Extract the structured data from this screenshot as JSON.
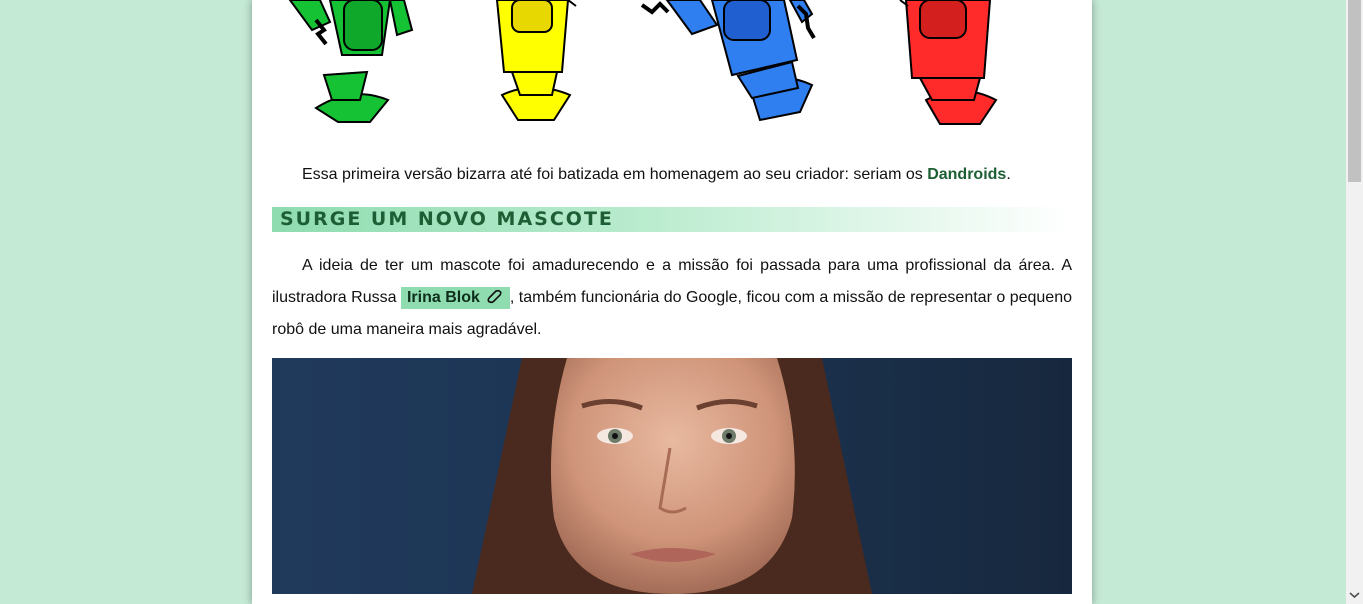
{
  "article": {
    "intro_text": "Essa primeira versão bizarra até foi batizada em homenagem ao seu criador: seriam os ",
    "dandroids": "Dandroids",
    "intro_end": ".",
    "section_heading": "SURGE UM NOVO MASCOTE",
    "p2_before": "A ideia de ter um mascote foi amadurecendo e a missão foi passada para uma profissional da área. A ilustradora Russa ",
    "link_label": "Irina Blok",
    "p2_after": ", também funcionária do Google, ficou com a missão de representar o pequeno robô de uma maneira mais agradável."
  },
  "mascots": {
    "colors": [
      "#1ccc3a",
      "#ffff00",
      "#2f7ff0",
      "#ff2a2a"
    ],
    "icon": "dandroid-robots-illustration"
  },
  "photo": {
    "icon": "irina-blok-portrait-photo"
  },
  "link_icon": "paperclip-link-icon",
  "colors": {
    "background": "#c4e9d5",
    "accent": "#8fdcb0",
    "heading_text": "#1d5e34"
  }
}
